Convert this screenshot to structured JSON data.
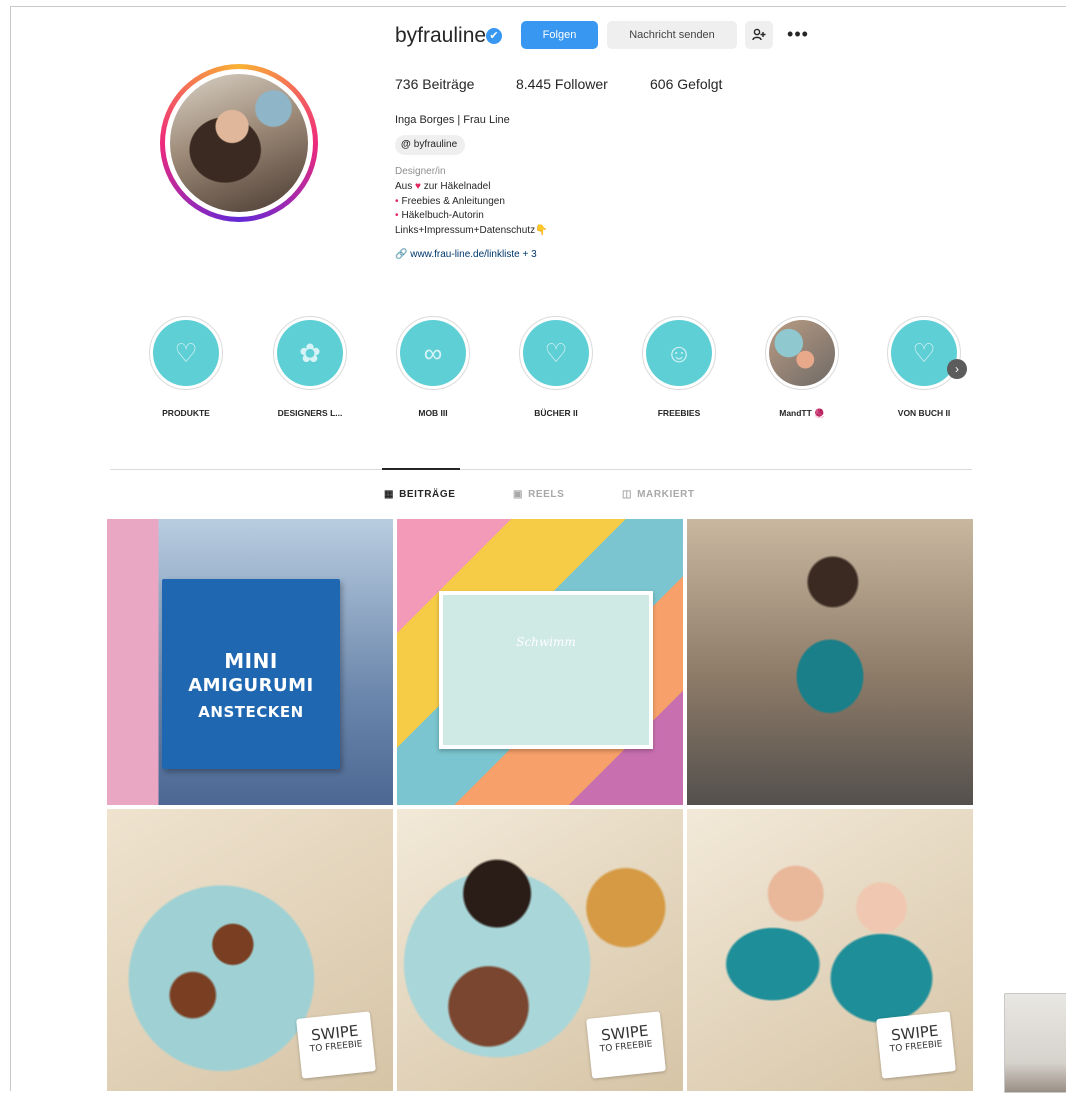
{
  "profile": {
    "username": "byfrauline",
    "verified_glyph": "✔",
    "follow_label": "Folgen",
    "message_label": "Nachricht senden",
    "suggest_icon": "add-user-icon",
    "more_icon": "•••",
    "stats": {
      "posts": "736 Beiträge",
      "followers": "8.445 Follower",
      "following": "606 Gefolgt"
    },
    "full_name": "Inga Borges | Frau Line",
    "threads_badge": "byfrauline",
    "category": "Designer/in",
    "bio": {
      "line1_pre": "Aus",
      "line1_post": "zur Häkelnadel",
      "line2": "Freebies & Anleitungen",
      "line3": "Häkelbuch-Autorin",
      "line4": "Links+Impressum+Datenschutz👇"
    },
    "link": "www.frau-line.de/linkliste + 3"
  },
  "highlights": [
    {
      "label": "PRODUKTE",
      "style": "teal"
    },
    {
      "label": "DESIGNERS L...",
      "style": "teal"
    },
    {
      "label": "MOB III",
      "style": "teal"
    },
    {
      "label": "BÜCHER II",
      "style": "teal"
    },
    {
      "label": "FREEBIES",
      "style": "teal"
    },
    {
      "label": "MandTT 🧶",
      "style": "photo"
    },
    {
      "label": "VON BUCH II",
      "style": "teal"
    }
  ],
  "tabs": [
    {
      "label": "BEITRÄGE",
      "icon": "grid-icon",
      "active": true
    },
    {
      "label": "REELS",
      "icon": "reels-icon",
      "active": false
    },
    {
      "label": "MARKIERT",
      "icon": "tagged-icon",
      "active": false
    }
  ],
  "posts": {
    "p1": {
      "book_line1": "MINI",
      "book_line2": "AMIGURUMI",
      "book_line3": "ANSTECKEN"
    },
    "p2": {
      "card_text": "Schwimm"
    },
    "swipe": {
      "main": "SWIPE",
      "sub": "TO FREEBIE"
    }
  },
  "colors": {
    "accent": "#3897f0",
    "highlight_teal": "#5fcfd6",
    "link": "#00376b"
  }
}
